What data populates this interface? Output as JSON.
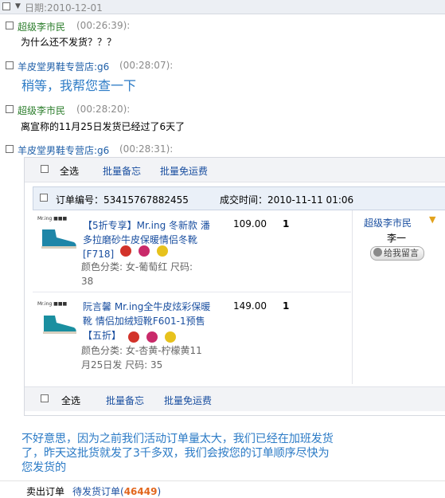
{
  "date_row": {
    "label": "日期:2010-12-01"
  },
  "messages": [
    {
      "sender": "超级李市民",
      "time": "(00:26:39):",
      "text": "为什么还不发货？？？"
    },
    {
      "sender": "羊皮堂男鞋专营店:g6",
      "time": "(00:28:07):",
      "text": "稍等，我帮您查一下"
    },
    {
      "sender": "超级李市民",
      "time": "(00:28:20):",
      "text": "离宣称的11月25日发货已经过了6天了"
    },
    {
      "sender": "羊皮堂男鞋专营店:g6",
      "time": "(00:28:31):"
    }
  ],
  "toolbar": {
    "select_all": "全选",
    "batch_note": "批量备忘",
    "batch_free_ship": "批量免运费"
  },
  "order": {
    "number_label": "订单编号：53415767882455",
    "time_label": "成交时间：2010-11-11 01:06",
    "buyer": "超级李市民",
    "name": "李一",
    "message_button": "给我留言",
    "items": [
      {
        "title_line1": "【5折专享】Mr.ing 冬新款 潘",
        "title_line2": "多拉磨砂牛皮保暖情侣冬靴",
        "title_line3": "[F718]",
        "attr_line1": "颜色分类: 女-葡萄红     尺码:",
        "attr_line2": "38",
        "price": "109.00",
        "qty": "1",
        "shoe_color": "#1e86a8"
      },
      {
        "title_line1": "阮言馨 Mr.ing全牛皮炫彩保暖",
        "title_line2": "靴 情侣加绒短靴F601-1预售",
        "title_line3": "【五折】",
        "attr_line1": "颜色分类: 女-杏黄-柠檬黄11",
        "attr_line2": "月25日发     尺码: 35",
        "price": "149.00",
        "qty": "1",
        "shoe_color": "#1a8fa0"
      }
    ]
  },
  "reply": {
    "line1": "不好意思，因为之前我们活动订单量太大，我们已经在加班发货",
    "line2": "了，昨天这批货就发了3千多双，我们会按您的订单顺序尽快为",
    "line3": "您发货的"
  },
  "footer": {
    "sold_orders": "卖出订单",
    "pending_label": "待发货订单(",
    "pending_count": "46449",
    "pending_close": ")"
  },
  "colors": {
    "sender_green": "#2b7d2b",
    "sender_blue": "#1f5fa8",
    "reply_blue": "#2c7bc6",
    "count_orange": "#e2661c"
  }
}
